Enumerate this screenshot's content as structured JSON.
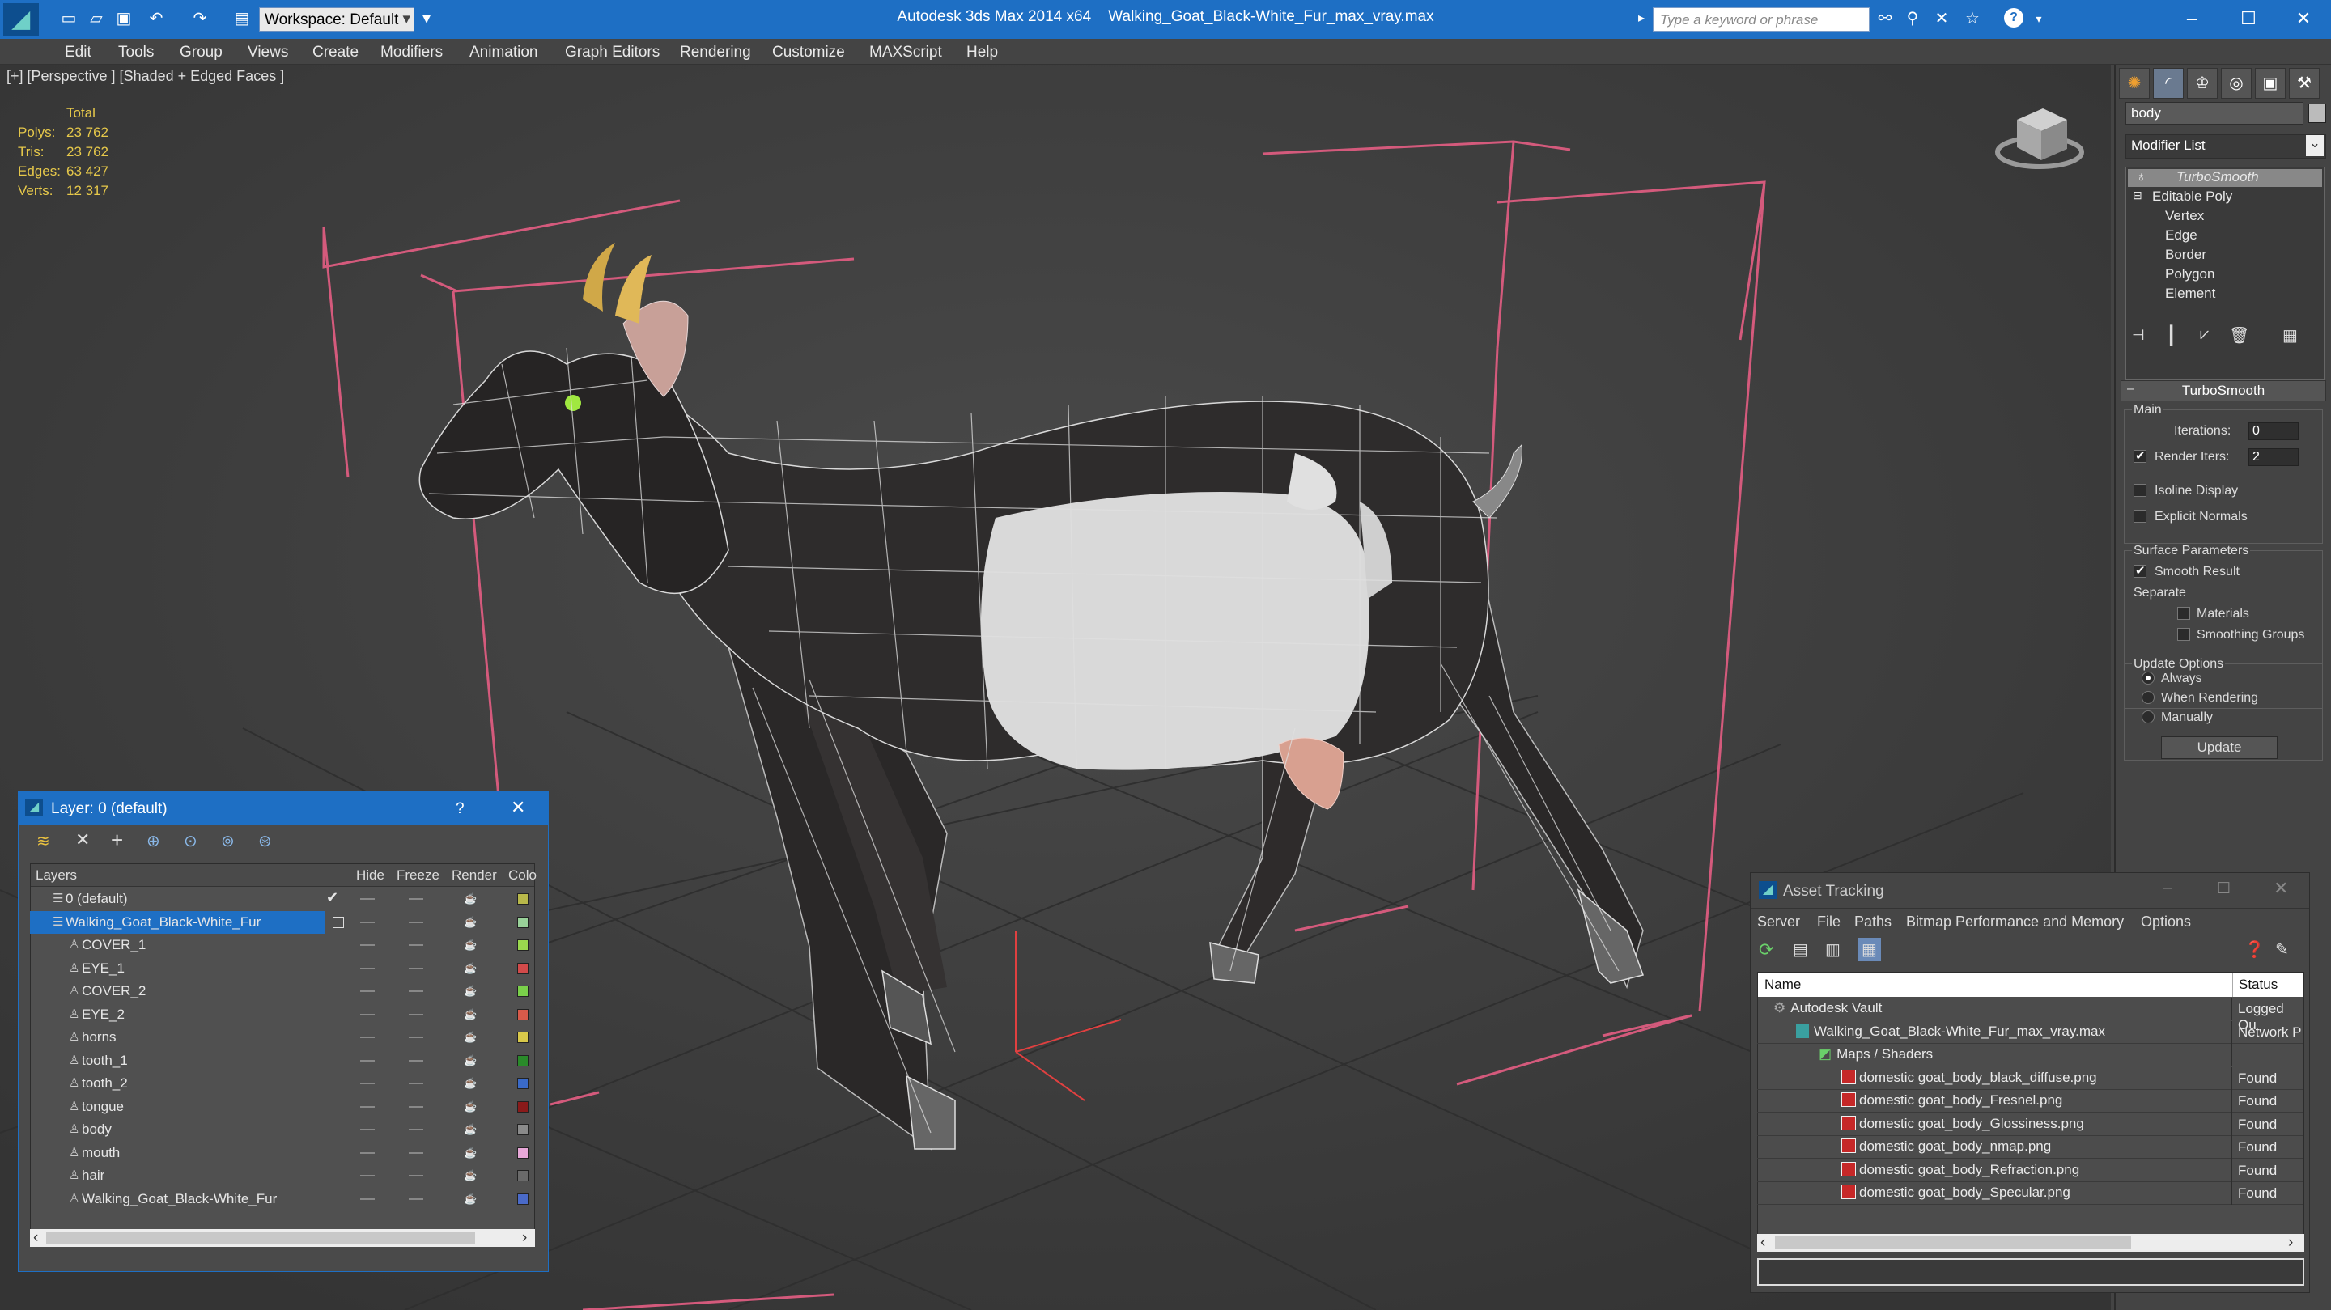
{
  "titlebar": {
    "app": "Autodesk 3ds Max  2014 x64",
    "file": "Walking_Goat_Black-White_Fur_max_vray.max",
    "workspace": "Workspace: Default",
    "search_placeholder": "Type a keyword or phrase"
  },
  "menu": [
    "Edit",
    "Tools",
    "Group",
    "Views",
    "Create",
    "Modifiers",
    "Animation",
    "Graph Editors",
    "Rendering",
    "Customize",
    "MAXScript",
    "Help"
  ],
  "viewport": {
    "label": "[+] [Perspective ] [Shaded + Edged Faces ]",
    "stats": {
      "header": "Total",
      "rows": [
        {
          "label": "Polys:",
          "value": "23 762"
        },
        {
          "label": "Tris:",
          "value": "23 762"
        },
        {
          "label": "Edges:",
          "value": "63 427"
        },
        {
          "label": "Verts:",
          "value": "12 317"
        }
      ]
    }
  },
  "command_panel": {
    "object_name": "body",
    "modifier_list": "Modifier List",
    "stack": {
      "turbosmooth": "TurboSmooth",
      "editable_poly": "Editable Poly",
      "subobjects": [
        "Vertex",
        "Edge",
        "Border",
        "Polygon",
        "Element"
      ]
    },
    "rollout": {
      "title": "TurboSmooth",
      "main_label": "Main",
      "iterations_label": "Iterations:",
      "iterations_value": "0",
      "render_iters_label": "Render Iters:",
      "render_iters_value": "2",
      "render_iters_checked": true,
      "isoline_label": "Isoline Display",
      "explicit_label": "Explicit Normals",
      "surface_label": "Surface Parameters",
      "smooth_label": "Smooth Result",
      "separate_label": "Separate",
      "materials_label": "Materials",
      "smoothing_label": "Smoothing Groups",
      "update_label": "Update Options",
      "always_label": "Always",
      "when_label": "When Rendering",
      "manually_label": "Manually",
      "update_button": "Update"
    }
  },
  "layer_dialog": {
    "title": "Layer: 0 (default)",
    "help": "?",
    "columns": {
      "layers": "Layers",
      "hide": "Hide",
      "freeze": "Freeze",
      "render": "Render",
      "color": "Colo"
    },
    "rows": [
      {
        "name": "0 (default)",
        "color": "#b8b84a",
        "level": 0
      },
      {
        "name": "Walking_Goat_Black-White_Fur",
        "color": "#9ad29a",
        "level": 0,
        "selected": true
      },
      {
        "name": "COVER_1",
        "color": "#9ad84e",
        "level": 1
      },
      {
        "name": "EYE_1",
        "color": "#d24a4a",
        "level": 1
      },
      {
        "name": "COVER_2",
        "color": "#7ad04a",
        "level": 1
      },
      {
        "name": "EYE_2",
        "color": "#d85a4a",
        "level": 1
      },
      {
        "name": "horns",
        "color": "#d8c84a",
        "level": 1
      },
      {
        "name": "tooth_1",
        "color": "#2a8a2a",
        "level": 1
      },
      {
        "name": "tooth_2",
        "color": "#3a6ac8",
        "level": 1
      },
      {
        "name": "tongue",
        "color": "#8a1a1a",
        "level": 1
      },
      {
        "name": "body",
        "color": "#8a8a8a",
        "level": 1
      },
      {
        "name": "mouth",
        "color": "#e8a8d8",
        "level": 1
      },
      {
        "name": "hair",
        "color": "#6a6a6a",
        "level": 1
      },
      {
        "name": "Walking_Goat_Black-White_Fur",
        "color": "#4a6ac8",
        "level": 1
      }
    ]
  },
  "asset_tracking": {
    "title": "Asset Tracking",
    "menu": [
      "Server",
      "File",
      "Paths",
      "Bitmap Performance and Memory",
      "Options"
    ],
    "columns": {
      "name": "Name",
      "status": "Status"
    },
    "rows": [
      {
        "name": "Autodesk Vault",
        "status": "Logged Ou",
        "level": 0,
        "kind": "vault"
      },
      {
        "name": "Walking_Goat_Black-White_Fur_max_vray.max",
        "status": "Network P",
        "level": 1,
        "kind": "max"
      },
      {
        "name": "Maps / Shaders",
        "status": "",
        "level": 2,
        "kind": "maps"
      },
      {
        "name": "domestic goat_body_black_diffuse.png",
        "status": "Found",
        "level": 3,
        "kind": "png"
      },
      {
        "name": "domestic goat_body_Fresnel.png",
        "status": "Found",
        "level": 3,
        "kind": "png"
      },
      {
        "name": "domestic goat_body_Glossiness.png",
        "status": "Found",
        "level": 3,
        "kind": "png"
      },
      {
        "name": "domestic goat_body_nmap.png",
        "status": "Found",
        "level": 3,
        "kind": "png"
      },
      {
        "name": "domestic goat_body_Refraction.png",
        "status": "Found",
        "level": 3,
        "kind": "png"
      },
      {
        "name": "domestic goat_body_Specular.png",
        "status": "Found",
        "level": 3,
        "kind": "png"
      }
    ]
  }
}
